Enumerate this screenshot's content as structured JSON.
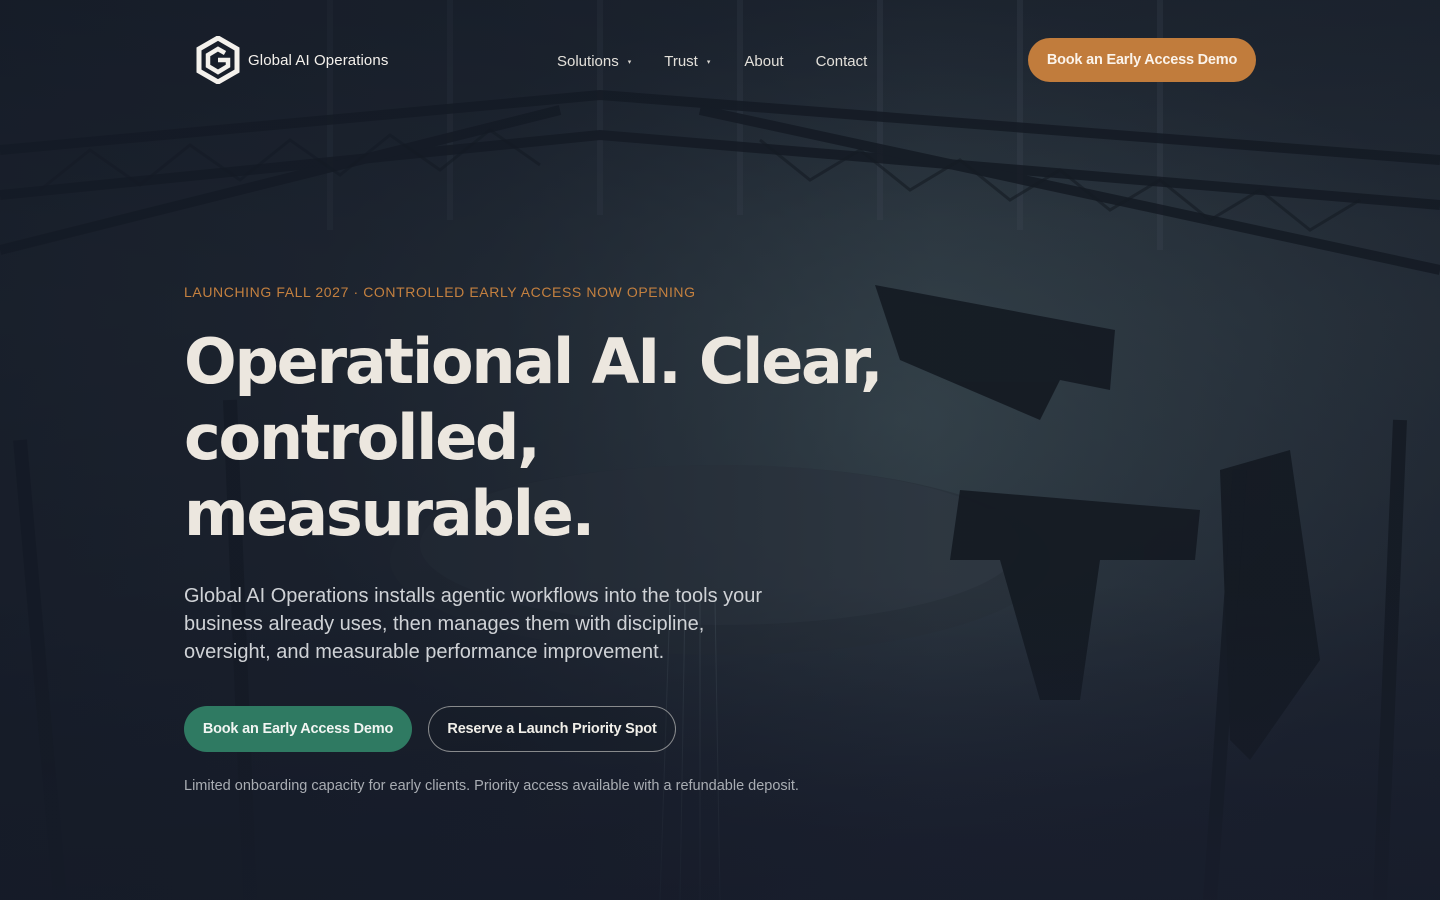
{
  "brand": {
    "name": "Global AI Operations",
    "logo_icon": "hexagon-g-logo-icon"
  },
  "nav": {
    "items": [
      {
        "label": "Solutions",
        "has_dropdown": true
      },
      {
        "label": "Trust",
        "has_dropdown": true
      },
      {
        "label": "About",
        "has_dropdown": false
      },
      {
        "label": "Contact",
        "has_dropdown": false
      }
    ],
    "caret": "▾"
  },
  "header_cta": {
    "label": "Book an Early Access Demo"
  },
  "hero": {
    "eyebrow": "LAUNCHING FALL 2027 · CONTROLLED EARLY ACCESS NOW OPENING",
    "headline": "Operational AI. Clear, controlled, measurable.",
    "lead": "Global AI Operations installs agentic workflows into the tools your business already uses, then manages them with discipline, oversight, and measurable performance improvement.",
    "primary_cta": "Book an Early Access Demo",
    "secondary_cta": "Reserve a Launch Priority Spot",
    "note": "Limited onboarding capacity for early clients. Priority access available with a refundable deposit."
  },
  "colors": {
    "accent_orange": "#c17c3c",
    "accent_green": "#2f7a62",
    "background": "#1a202b",
    "heading": "#ece7df"
  }
}
